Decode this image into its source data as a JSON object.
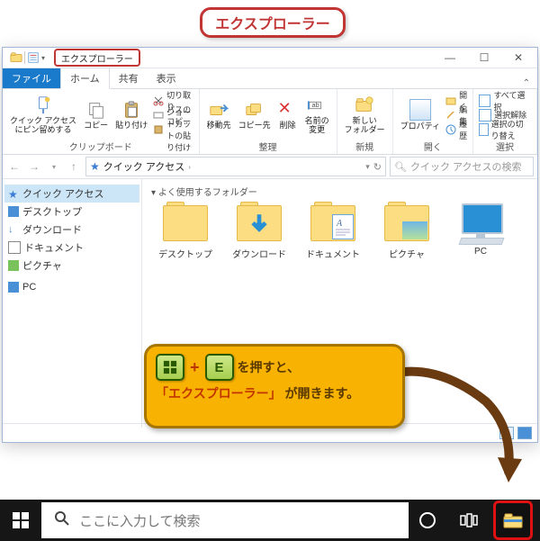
{
  "callout_title": "エクスプローラー",
  "explorer": {
    "window_label": "エクスプローラー",
    "tabs": {
      "file": "ファイル",
      "home": "ホーム",
      "share": "共有",
      "view": "表示"
    },
    "ribbon": {
      "quick_access": "クイック アクセス\nにピン留めする",
      "copy": "コピー",
      "paste": "貼り付け",
      "cut": "切り取り",
      "copy_path": "パスのコピー",
      "paste_shortcut": "ショートカットの貼り付け",
      "group_clipboard": "クリップボード",
      "move_to": "移動先",
      "copy_to": "コピー先",
      "delete": "削除",
      "rename": "名前の\n変更",
      "group_organize": "整理",
      "new_folder": "新しい\nフォルダー",
      "group_new": "新規",
      "properties": "プロパティ",
      "open": "開く",
      "edit": "編集",
      "history": "履歴",
      "group_open": "開く",
      "select_all": "すべて選択",
      "select_none": "選択解除",
      "invert_selection": "選択の切り替え",
      "group_select": "選択"
    },
    "address": {
      "location": "クイック アクセス",
      "search_placeholder": "クイック アクセスの検索"
    },
    "nav": {
      "quick_access": "クイック アクセス",
      "desktop": "デスクトップ",
      "downloads": "ダウンロード",
      "documents": "ドキュメント",
      "pictures": "ピクチャ",
      "pc": "PC"
    },
    "content": {
      "frequent_folders": "よく使用するフォルダー",
      "items": {
        "desktop": "デスクトップ",
        "downloads": "ダウンロード",
        "documents": "ドキュメント",
        "pictures": "ピクチャ",
        "pc": "PC"
      }
    }
  },
  "tip": {
    "key_e": "E",
    "text1": "を押すと、",
    "text2a": "「エクスプローラー」",
    "text2b": " が開きます。"
  },
  "taskbar": {
    "search_placeholder": "ここに入力して検索"
  }
}
